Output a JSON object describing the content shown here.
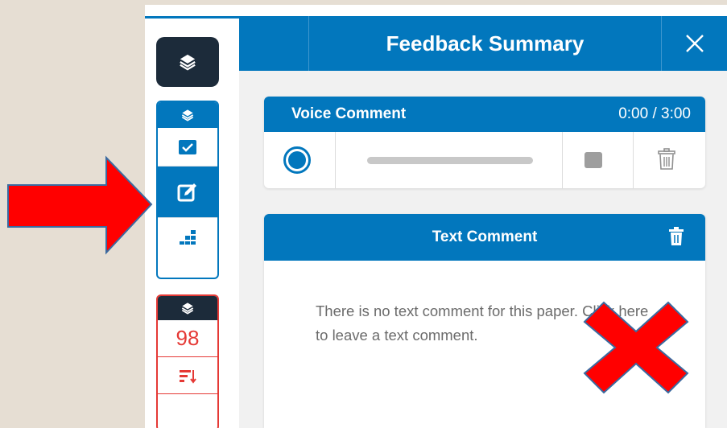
{
  "panel": {
    "title": "Feedback Summary"
  },
  "voice_comment": {
    "title": "Voice Comment",
    "time": "0:00 / 3:00",
    "progress_fraction": 0
  },
  "text_comment": {
    "title": "Text Comment",
    "empty_message": "There is no text comment for this paper. Click here to leave a text comment."
  },
  "toolbar": {
    "score": "98",
    "tools": [
      "layers-icon",
      "check-icon",
      "edit-icon",
      "rubric-grid-icon",
      "sort-icon"
    ]
  },
  "colors": {
    "primary": "#0277bd",
    "dark": "#1c2b3a",
    "score_red": "#e53935",
    "annotation_red": "#ff0000",
    "background": "#e6ded3"
  }
}
